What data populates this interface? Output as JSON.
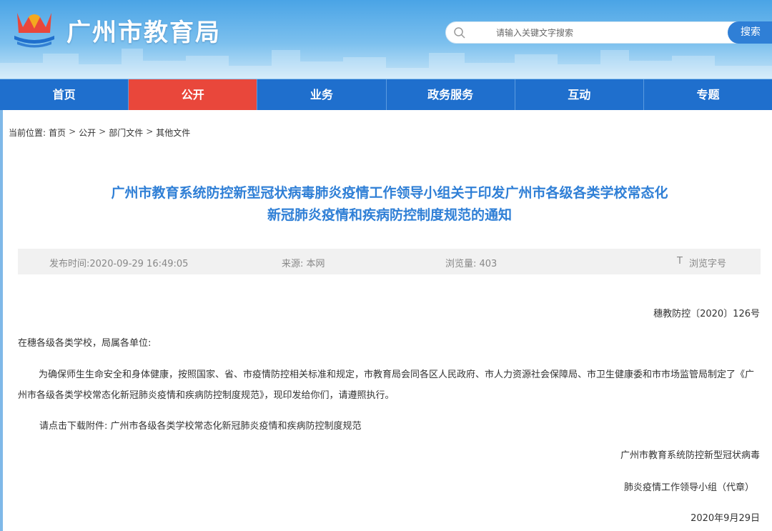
{
  "header": {
    "site_title": "广州市教育局",
    "logo_icon": "education-bureau-logo-icon",
    "search": {
      "placeholder": "请输入关键文字搜索",
      "button_label": "搜索",
      "icon": "search-icon"
    }
  },
  "nav": {
    "items": [
      {
        "label": "首页",
        "active": false
      },
      {
        "label": "公开",
        "active": true
      },
      {
        "label": "业务",
        "active": false
      },
      {
        "label": "政务服务",
        "active": false
      },
      {
        "label": "互动",
        "active": false
      },
      {
        "label": "专题",
        "active": false
      }
    ]
  },
  "breadcrumb": {
    "prefix": "当前位置:",
    "items": [
      "首页",
      "公开",
      "部门文件",
      "其他文件"
    ],
    "separator": ">"
  },
  "article": {
    "title_line1": "广州市教育系统防控新型冠状病毒肺炎疫情工作领导小组关于印发广州市各级各类学校常态化",
    "title_line2": "新冠肺炎疫情和疾病防控制度规范的通知",
    "meta": {
      "publish_time": "发布时间:2020-09-29 16:49:05",
      "source": "来源: 本网",
      "views": "浏览量: 403",
      "font_size_icon": "T",
      "font_size_label": "浏览字号"
    },
    "doc_number": "穗教防控〔2020〕126号",
    "salutation": "在穗各级各类学校，局属各单位:",
    "body": "为确保师生生命安全和身体健康，按照国家、省、市疫情防控相关标准和规定，市教育局会同各区人民政府、市人力资源社会保障局、市卫生健康委和市市场监管局制定了《广州市各级各类学校常态化新冠肺炎疫情和疾病防控制度规范》，现印发给你们，请遵照执行。",
    "attachment_prefix": "请点击下载附件:",
    "attachment_link": "广州市各级各类学校常态化新冠肺炎疫情和疾病防控制度规范",
    "signer_line1": "广州市教育系统防控新型冠状病毒",
    "signer_line2": "肺炎疫情工作领导小组（代章）",
    "date": "2020年9月29日"
  },
  "colors": {
    "nav_bg": "#1f6fcd",
    "nav_active": "#e9473b",
    "title_blue": "#2f7fd6"
  }
}
